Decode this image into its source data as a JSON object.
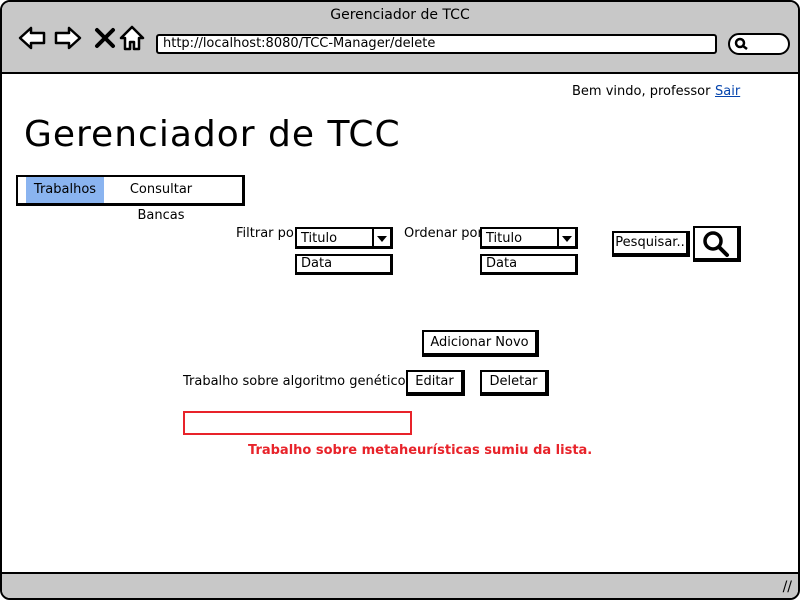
{
  "browser": {
    "title": "Gerenciador de TCC",
    "url": "http://localhost:8080/TCC-Manager/delete",
    "icons": [
      "back-arrow-icon",
      "forward-arrow-icon",
      "close-icon",
      "home-icon",
      "search-icon",
      "resize-grip-icon"
    ]
  },
  "header": {
    "welcome": "Bem vindo, professor",
    "logout": "Sair"
  },
  "page": {
    "title": "Gerenciador de TCC"
  },
  "tabs": [
    {
      "label": "Trabalhos",
      "active": true
    },
    {
      "label": "Consultar Bancas",
      "active": false
    }
  ],
  "filter": {
    "label": "Filtrar por",
    "selected": "Titulo",
    "options": [
      "Data"
    ]
  },
  "order": {
    "label": "Ordenar por",
    "selected": "Titulo",
    "options": [
      "Data"
    ]
  },
  "search": {
    "button_label": "Pesquisar.."
  },
  "actions": {
    "add_new": "Adicionar Novo"
  },
  "items": [
    {
      "title": "Trabalho sobre algoritmo genético",
      "edit_label": "Editar",
      "delete_label": "Deletar"
    }
  ],
  "annotation": {
    "text": "Trabalho sobre metaheurísticas sumiu da lista.",
    "color": "#e8232a"
  },
  "colors": {
    "active_tab": "#8ab4f0",
    "chrome": "#c8c8c8",
    "link": "#0645ad"
  }
}
